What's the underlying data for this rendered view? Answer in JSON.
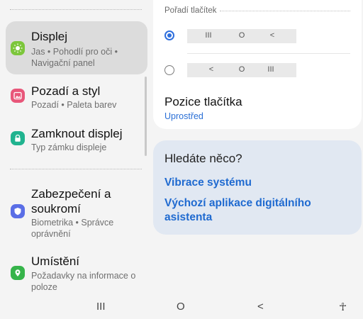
{
  "left_menu": {
    "items": [
      {
        "title": "Displej",
        "subtitle": "Jas  •  Pohodlí pro oči  •  Navigační panel",
        "icon": "sun-icon",
        "color": "#7cc63b",
        "selected": true
      },
      {
        "title": "Pozadí a styl",
        "subtitle": "Pozadí  •  Paleta barev",
        "icon": "image-icon",
        "color": "#e8577a"
      },
      {
        "title": "Zamknout displej",
        "subtitle": "Typ zámku displeje",
        "icon": "lock-icon",
        "color": "#20b38f"
      },
      {
        "title": "Zabezpečení a soukromí",
        "subtitle": "Biometrika  •  Správce oprávnění",
        "icon": "shield-icon",
        "color": "#5a6ee6"
      },
      {
        "title": "Umístění",
        "subtitle": "Požadavky na informace o poloze",
        "icon": "location-icon",
        "color": "#36b44a"
      }
    ]
  },
  "button_order": {
    "header": "Pořadí tlačítek",
    "options": [
      {
        "selected": true,
        "glyphs": [
          "III",
          "O",
          "<"
        ]
      },
      {
        "selected": false,
        "glyphs": [
          "<",
          "O",
          "III"
        ]
      }
    ]
  },
  "button_position": {
    "title": "Pozice tlačítka",
    "value": "Uprostřed"
  },
  "search_card": {
    "question": "Hledáte něco?",
    "links": [
      "Vibrace systému",
      "Výchozí aplikace digitálního asistenta"
    ]
  },
  "navbar": {
    "recents": "III",
    "home": "O",
    "back": "<",
    "accessibility": "☥"
  },
  "colors": {
    "accent": "#2a6fd6",
    "selected_bg": "#dcdcdc",
    "search_bg": "#e1e8f2"
  }
}
